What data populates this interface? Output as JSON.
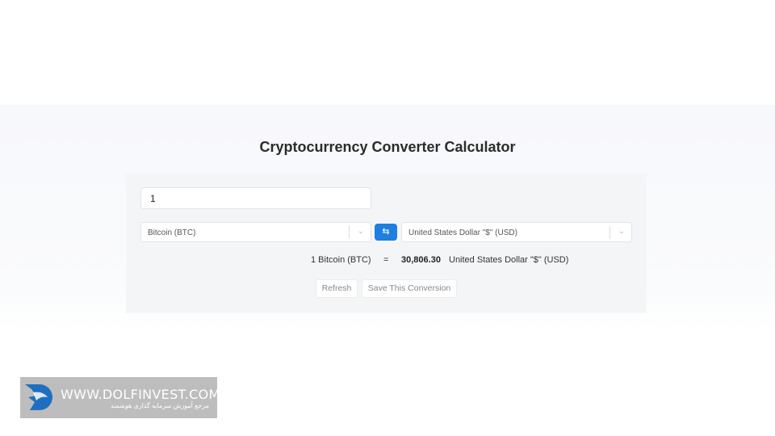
{
  "page": {
    "title": "Cryptocurrency Converter Calculator"
  },
  "converter": {
    "amount": "1",
    "from_currency": "Bitcoin (BTC)",
    "to_currency": "United States Dollar \"$\" (USD)",
    "swap_icon": "swap-arrows-icon",
    "result": {
      "from_text": "1 Bitcoin (BTC)",
      "equals": "=",
      "value": "30,806.30",
      "to_text": "United States Dollar \"$\" (USD)"
    },
    "refresh_label": "Refresh",
    "save_label": "Save This Conversion",
    "accent_color": "#1e7fe0"
  },
  "watermark": {
    "url": "WWW.DOLFINVEST.COM",
    "tagline": "مرجع آموزش سرمایه گذاری هوشمند"
  }
}
